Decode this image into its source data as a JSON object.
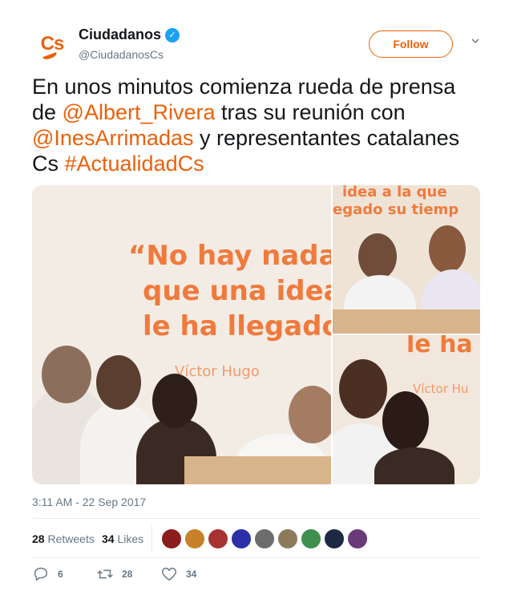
{
  "account": {
    "display_name": "Ciudadanos",
    "handle": "@CiudadanosCs",
    "logo_text": "Cs",
    "brand_color": "#eb6109",
    "verified_icon": "verified-badge-icon"
  },
  "follow_label": "Follow",
  "tweet": {
    "parts": [
      {
        "text": "En unos minutos comienza rueda de prensa de ",
        "link": false
      },
      {
        "text": "@Albert_Rivera",
        "link": true
      },
      {
        "text": " tras su reunión con ",
        "link": false
      },
      {
        "text": "@InesArrimadas",
        "link": true
      },
      {
        "text": " y representantes catalanes Cs ",
        "link": false
      },
      {
        "text": "#ActualidadCs",
        "link": true
      }
    ]
  },
  "media": {
    "main_quote_lines": [
      "“No hay nada",
      "que una idea",
      "le ha llegado"
    ],
    "main_author": "Víctor Hugo",
    "tr_quote_lines": [
      "idea a la que",
      "egado su tiemp"
    ],
    "br_quote_line": "le ha",
    "br_author": "Víctor Hu"
  },
  "timestamp": "3:11 AM - 22 Sep 2017",
  "stats": {
    "retweets_count": "28",
    "retweets_label": "Retweets",
    "likes_count": "34",
    "likes_label": "Likes"
  },
  "likers": [
    {
      "icon": "liker-avatar-1",
      "color": "#8b1d1d"
    },
    {
      "icon": "liker-avatar-2",
      "color": "#c7812a"
    },
    {
      "icon": "liker-avatar-3",
      "color": "#a83232"
    },
    {
      "icon": "liker-avatar-4",
      "color": "#2b2fa8"
    },
    {
      "icon": "liker-avatar-5",
      "color": "#6d6d6d"
    },
    {
      "icon": "liker-avatar-6",
      "color": "#8c7b5a"
    },
    {
      "icon": "liker-avatar-7",
      "color": "#3f8f4f"
    },
    {
      "icon": "liker-avatar-8",
      "color": "#1e2a44"
    },
    {
      "icon": "liker-avatar-9",
      "color": "#6a3a7a"
    }
  ],
  "actions": {
    "reply_count": "6",
    "retweet_count": "28",
    "like_count": "34"
  }
}
